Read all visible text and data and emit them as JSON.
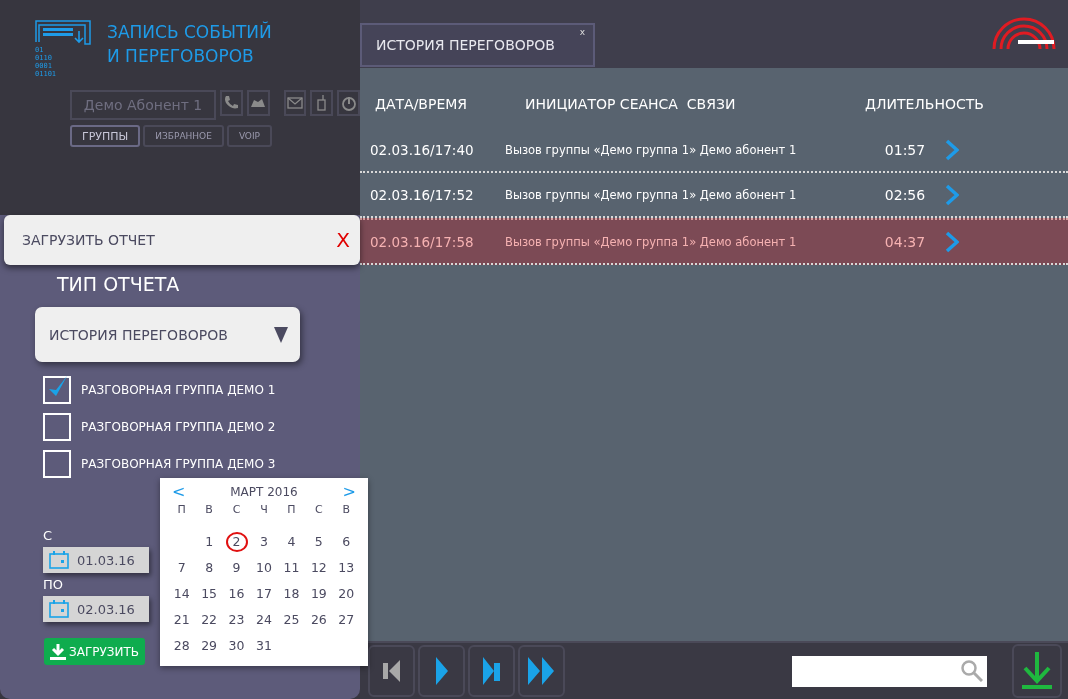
{
  "app": {
    "logo_bits": [
      "01",
      "0110",
      "0001",
      "01101"
    ],
    "title_lines": [
      "ЗАПИСЬ СОБЫТИЙ",
      "И ПЕРЕГОВОРОВ"
    ]
  },
  "subscriber": {
    "value": "Демо Абонент 1"
  },
  "nav_tabs": [
    {
      "label": "ГРУППЫ",
      "selected": true
    },
    {
      "label": "ИЗБРАННОЕ",
      "selected": false
    },
    {
      "label": "VOIP",
      "selected": false
    }
  ],
  "doc_tabs": [
    {
      "label": "ИСТОРИЯ ПЕРЕГОВОРОВ",
      "close": "x",
      "selected": true
    }
  ],
  "table": {
    "columns": [
      "ДАТА/ВРЕМЯ",
      "ИНИЦИАТОР СЕАНСА  СВЯЗИ",
      "ДЛИТЕЛЬНОСТЬ"
    ],
    "rows": [
      {
        "datetime": "02.03.16/17:40",
        "initiator": "Вызов группы «Демо группа 1» Демо абонент 1",
        "duration": "01:57",
        "selected": false
      },
      {
        "datetime": "02.03.16/17:52",
        "initiator": "Вызов группы «Демо группа 1» Демо абонент 1",
        "duration": "02:56",
        "selected": false
      },
      {
        "datetime": "02.03.16/17:58",
        "initiator": "Вызов группы «Демо группа 1» Демо абонент 1",
        "duration": "04:37",
        "selected": true
      }
    ]
  },
  "report_dialog": {
    "title": "ЗАГРУЗИТЬ ОТЧЕТ",
    "close": "X",
    "type_label": "ТИП ОТЧЕТА",
    "type_value": "ИСТОРИЯ ПЕРЕГОВОРОВ",
    "groups": [
      {
        "label": "РАЗГОВОРНАЯ ГРУППА ДЕМО 1",
        "checked": true
      },
      {
        "label": "РАЗГОВОРНАЯ ГРУППА ДЕМО 2",
        "checked": false
      },
      {
        "label": "РАЗГОВОРНАЯ ГРУППА ДЕМО 3",
        "checked": false
      }
    ],
    "from_label": "С",
    "from": "01.03.16",
    "to_label": "ПО",
    "to": "02.03.16",
    "submit": "ЗАГРУЗИТЬ"
  },
  "calendar": {
    "prev": "<",
    "next": ">",
    "month": "МАРТ 2016",
    "weekdays": [
      "П",
      "В",
      "С",
      "Ч",
      "П",
      "С",
      "В"
    ],
    "weeks": [
      [
        {
          "label": "1",
          "selected": false
        },
        {
          "label": "2",
          "selected": true
        },
        {
          "label": "3",
          "selected": false
        },
        {
          "label": "4",
          "selected": false
        },
        {
          "label": "5",
          "selected": false
        },
        {
          "label": "6",
          "selected": false
        }
      ],
      [
        {
          "label": "7",
          "selected": false
        },
        {
          "label": "8",
          "selected": false
        },
        {
          "label": "9",
          "selected": false
        },
        {
          "label": "10",
          "selected": false
        },
        {
          "label": "11",
          "selected": false
        },
        {
          "label": "12",
          "selected": false
        },
        {
          "label": "13",
          "selected": false
        }
      ],
      [
        {
          "label": "14",
          "selected": false
        },
        {
          "label": "15",
          "selected": false
        },
        {
          "label": "16",
          "selected": false
        },
        {
          "label": "17",
          "selected": false
        },
        {
          "label": "18",
          "selected": false
        },
        {
          "label": "19",
          "selected": false
        },
        {
          "label": "20",
          "selected": false
        }
      ],
      [
        {
          "label": "21",
          "selected": false
        },
        {
          "label": "22",
          "selected": false
        },
        {
          "label": "23",
          "selected": false
        },
        {
          "label": "24",
          "selected": false
        },
        {
          "label": "25",
          "selected": false
        },
        {
          "label": "26",
          "selected": false
        },
        {
          "label": "27",
          "selected": false
        }
      ],
      [
        {
          "label": "28",
          "selected": false
        },
        {
          "label": "29",
          "selected": false
        },
        {
          "label": "30",
          "selected": false
        },
        {
          "label": "31",
          "selected": false
        }
      ]
    ]
  }
}
